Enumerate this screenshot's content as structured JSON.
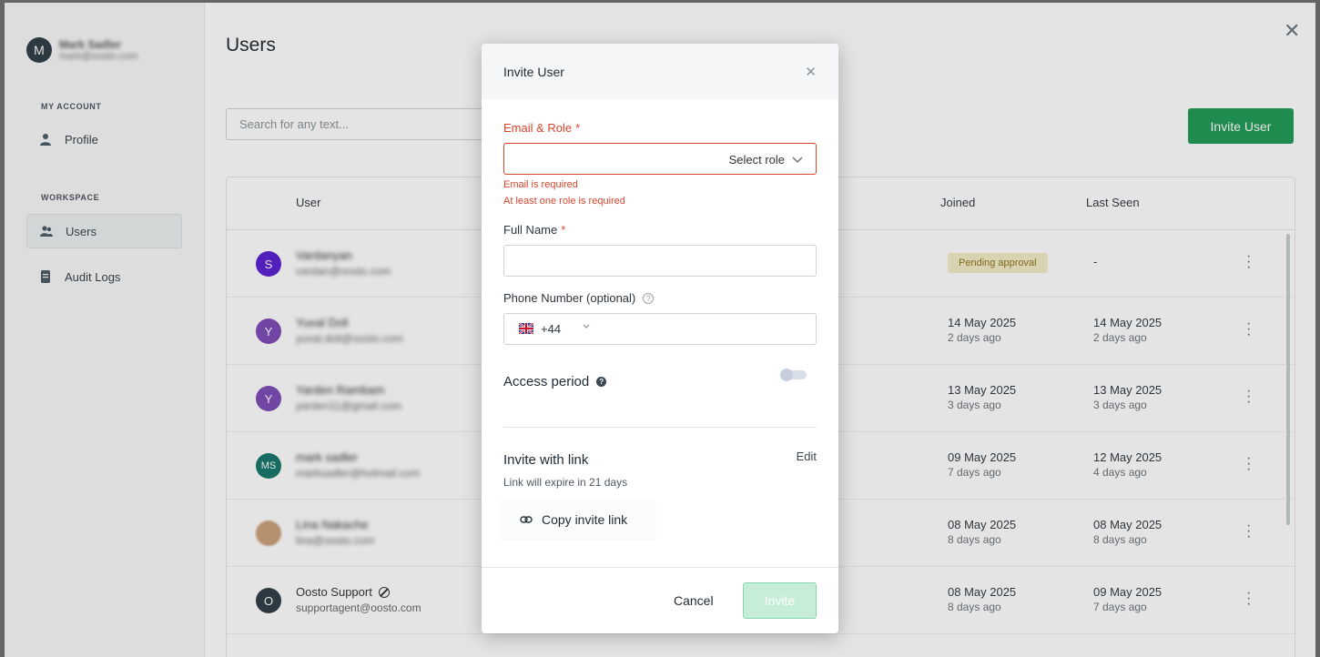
{
  "app": {
    "account": {
      "avatar_letter": "M",
      "name": "Mark Sadler",
      "email": "mark@oosto.com"
    },
    "sidebar": {
      "my_account_label": "MY ACCOUNT",
      "workspace_label": "WORKSPACE",
      "items": [
        {
          "label": "Profile",
          "icon": "person-icon"
        },
        {
          "label": "Users",
          "icon": "users-icon",
          "active": true
        },
        {
          "label": "Audit Logs",
          "icon": "document-icon"
        }
      ]
    },
    "page_title": "Users",
    "search_placeholder": "Search for any text...",
    "invite_user_label": "Invite User",
    "table": {
      "headers": {
        "user": "User",
        "joined": "Joined",
        "last_seen": "Last Seen"
      },
      "rows": [
        {
          "avatar": "S",
          "color": "#5a1fd0",
          "name": "Vardanyan",
          "email": "vardan@oosto.com",
          "status": "Pending approval",
          "last_seen": "-",
          "blurred": true
        },
        {
          "avatar": "Y",
          "color": "#7b4bb6",
          "name": "Yuval Doli",
          "email": "yuval.doli@oosto.com",
          "joined_date": "14 May 2025",
          "joined_ago": "2 days ago",
          "seen_date": "14 May 2025",
          "seen_ago": "2 days ago",
          "blurred": true
        },
        {
          "avatar": "Y",
          "color": "#7b4bb6",
          "name": "Yarden Rambam",
          "email": "yarden11@gmail.com",
          "joined_date": "13 May 2025",
          "joined_ago": "3 days ago",
          "seen_date": "13 May 2025",
          "seen_ago": "3 days ago",
          "blurred": true
        },
        {
          "avatar": "MS",
          "color": "#16776b",
          "name": "mark sadler",
          "email": "marksadler@hotmail.com",
          "joined_date": "09 May 2025",
          "joined_ago": "7 days ago",
          "seen_date": "12 May 2025",
          "seen_ago": "4 days ago",
          "blurred": true
        },
        {
          "avatar": "",
          "color": "#c9a07a",
          "name": "Lina Nakache",
          "email": "lina@oosto.com",
          "joined_date": "08 May 2025",
          "joined_ago": "8 days ago",
          "seen_date": "08 May 2025",
          "seen_ago": "8 days ago",
          "blurred": true
        },
        {
          "avatar": "O",
          "color": "#2f3d45",
          "name": "Oosto Support",
          "email": "supportagent@oosto.com",
          "joined_date": "08 May 2025",
          "joined_ago": "8 days ago",
          "seen_date": "09 May 2025",
          "seen_ago": "7 days ago",
          "blurred": false
        }
      ]
    }
  },
  "modal": {
    "title": "Invite User",
    "email_role_label": "Email & Role",
    "required_mark": "*",
    "select_role": "Select role",
    "email_error": "Email is required",
    "role_error": "At least one role is required",
    "full_name_label": "Full Name",
    "phone_label": "Phone Number (optional)",
    "dial_code": "+44",
    "access_period_label": "Access period",
    "access_period_enabled": false,
    "invite_with_link": "Invite with link",
    "edit_label": "Edit",
    "link_expire": "Link will expire in 21 days",
    "copy_invite_link": "Copy invite link",
    "cancel_label": "Cancel",
    "invite_label": "Invite"
  },
  "colors": {
    "primary": "#1f9a55",
    "error": "#d6452c",
    "disabled_primary": "#c6eed6"
  }
}
